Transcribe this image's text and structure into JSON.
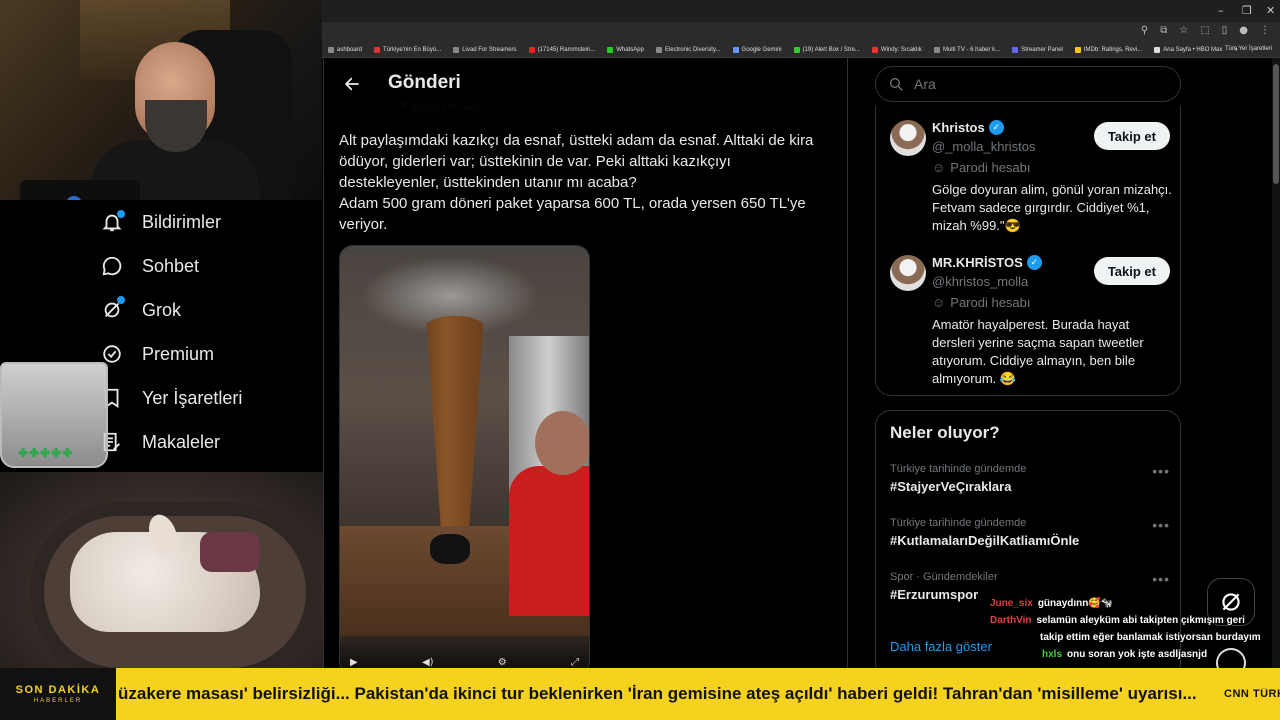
{
  "browser": {
    "bookmarks": [
      {
        "label": "ashboard",
        "color": "#888"
      },
      {
        "label": "Türkiye'nin En Büyü...",
        "color": "#d33"
      },
      {
        "label": "Livad For Streamers",
        "color": "#888"
      },
      {
        "label": "(17145) Rammstein...",
        "color": "#e22"
      },
      {
        "label": "WhatsApp",
        "color": "#2c2"
      },
      {
        "label": "Electronic Diversity...",
        "color": "#888"
      },
      {
        "label": "Google Gemini",
        "color": "#69f"
      },
      {
        "label": "(19) Alert Box / Stre...",
        "color": "#3c3"
      },
      {
        "label": "Windy: Sıcaklık",
        "color": "#e33"
      },
      {
        "label": "Multi TV - 6 haber k...",
        "color": "#888"
      },
      {
        "label": "Streamer Panel",
        "color": "#66f"
      },
      {
        "label": "IMDb: Ratings, Revi...",
        "color": "#f5c518"
      },
      {
        "label": "Ana Sayfa • HBO Max",
        "color": "#ddd"
      }
    ],
    "bookmarks_more": "»",
    "all_bookmarks": "Tüm Yer İşaretleri"
  },
  "nav": {
    "items": [
      {
        "label": "Bildirimler",
        "icon": "bell-icon"
      },
      {
        "label": "Sohbet",
        "icon": "chat-icon"
      },
      {
        "label": "Grok",
        "icon": "grok-icon"
      },
      {
        "label": "Premium",
        "icon": "premium-icon"
      },
      {
        "label": "Yer İşaretleri",
        "icon": "bookmark-icon"
      },
      {
        "label": "Makaleler",
        "icon": "articles-icon"
      }
    ]
  },
  "main": {
    "title": "Gönderi",
    "parody_label": "Parodi hesabı",
    "post_text": "Alt paylaşımdaki kazıkçı da esnaf, üstteki adam da esnaf. Alttaki de kira ödüyor, giderleri var; üsttekinin de var. Peki alttaki kazıkçıyı destekleyenler, üsttekinden utanır mı acaba?\nAdam 500 gram döneri paket yaparsa 600 TL, orada yersen 650 TL'ye veriyor."
  },
  "sidebar": {
    "search_placeholder": "Ara",
    "who_to_follow": [
      {
        "name": "Khristos",
        "handle": "@_molla_khristos",
        "parody": "Parodi hesabı",
        "bio": "Gölge doyuran alim, gönül yoran mizahçı. Fetvam sadece gırgırdır. Ciddiyet %1, mizah %99.\"😎",
        "follow": "Takip et"
      },
      {
        "name": "MR.KHRİSTOS",
        "handle": "@khristos_molla",
        "parody": "Parodi hesabı",
        "bio": "Amatör hayalperest. Burada hayat dersleri yerine saçma sapan tweetler atıyorum. Ciddiye almayın, ben bile almıyorum. 😂",
        "follow": "Takip et"
      }
    ],
    "trends_title": "Neler oluyor?",
    "trends": [
      {
        "context": "Türkiye tarihinde gündemde",
        "name": "#StajyerVeÇıraklara"
      },
      {
        "context": "Türkiye tarihinde gündemde",
        "name": "#KutlamalarıDeğilKatliamıÖnle"
      },
      {
        "context": "Spor · Gündemdekiler",
        "name": "#Erzurumspor"
      }
    ],
    "show_more": "Daha fazla göster"
  },
  "chat": [
    {
      "user": "June_six",
      "user_color": "#e04040",
      "message": "günaydınn🥰🐄"
    },
    {
      "user": "DarthVin",
      "user_color": "#e04040",
      "message": "selamün aleyküm abi takipten çıkmışım geri"
    },
    {
      "user": "",
      "user_color": "#ffffff",
      "message": "takip ettim eğer banlamak istiyorsan burdayım"
    },
    {
      "user": "hxls",
      "user_color": "#40d040",
      "message": "onu soran yok işte asdljasnjd"
    }
  ],
  "ticker": {
    "logo_main": "SON DAKİKA",
    "logo_sub": "HABERLER",
    "text": "üzakere masası' belirsizliği... Pakistan'da ikinci tur beklenirken 'İran gemisine ateş açıldı' haberi geldi! Tahran'dan 'misilleme' uyarısı...",
    "brand": "CNN TÜRK"
  },
  "colors": {
    "accent": "#1d9bf0",
    "ticker": "#f5d21e"
  }
}
